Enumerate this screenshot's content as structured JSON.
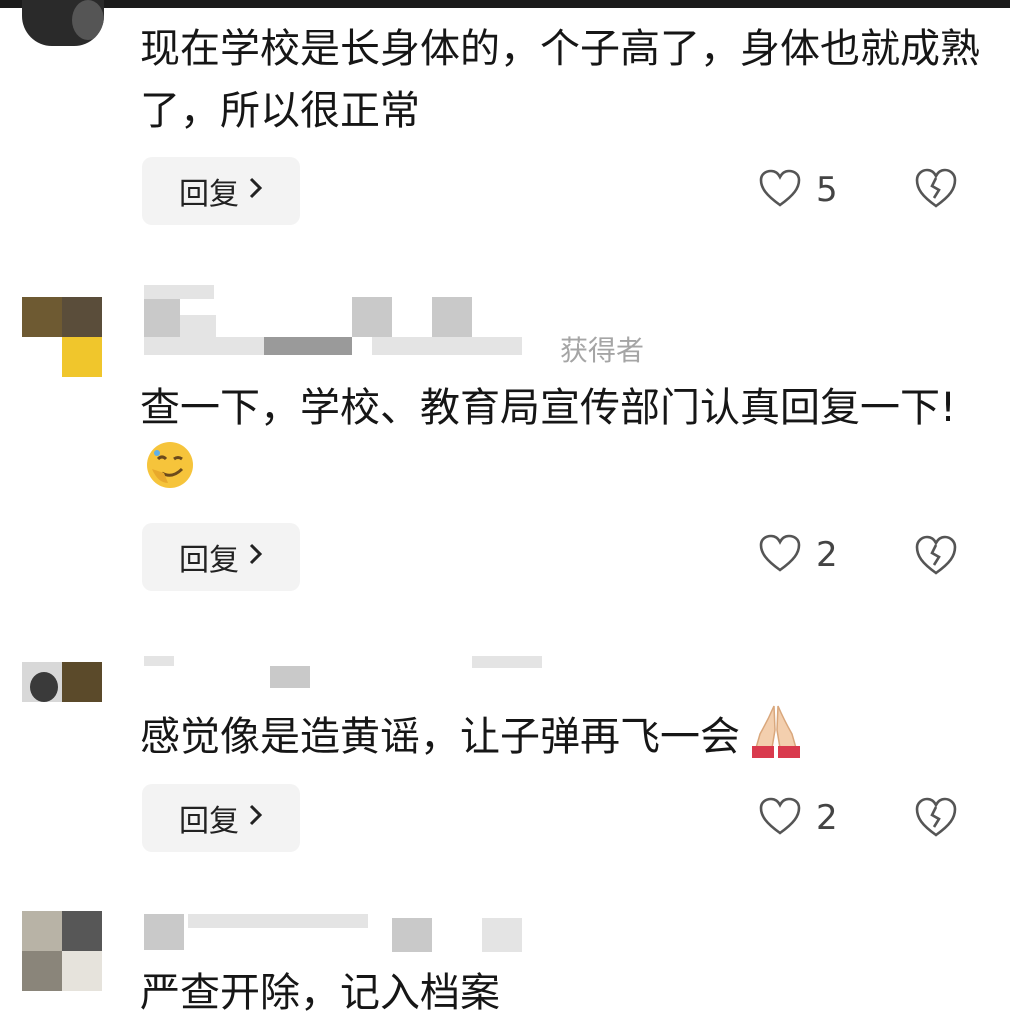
{
  "comments": [
    {
      "text": "现在学校是长身体的，个子高了，身体也就成熟了，所以很正常",
      "reply_label": "回复",
      "likes": "5"
    },
    {
      "meta_suffix": "获得者",
      "text": "查一下，学校、教育局宣传部门认真回复一下!",
      "reply_label": "回复",
      "likes": "2",
      "emoji": "smirk-face-emoji"
    },
    {
      "text": "感觉像是造黄谣，让子弹再飞一会",
      "reply_label": "回复",
      "likes": "2",
      "emoji": "folded-hands-emoji"
    },
    {
      "text": "严查开除，记入档案"
    }
  ],
  "icons": {
    "like": "heart-outline-icon",
    "dislike": "broken-heart-icon",
    "chevron": "chevron-right-icon"
  },
  "colors": {
    "text": "#161616",
    "meta": "#a5a5a5",
    "reply_bg": "#f3f3f3"
  }
}
